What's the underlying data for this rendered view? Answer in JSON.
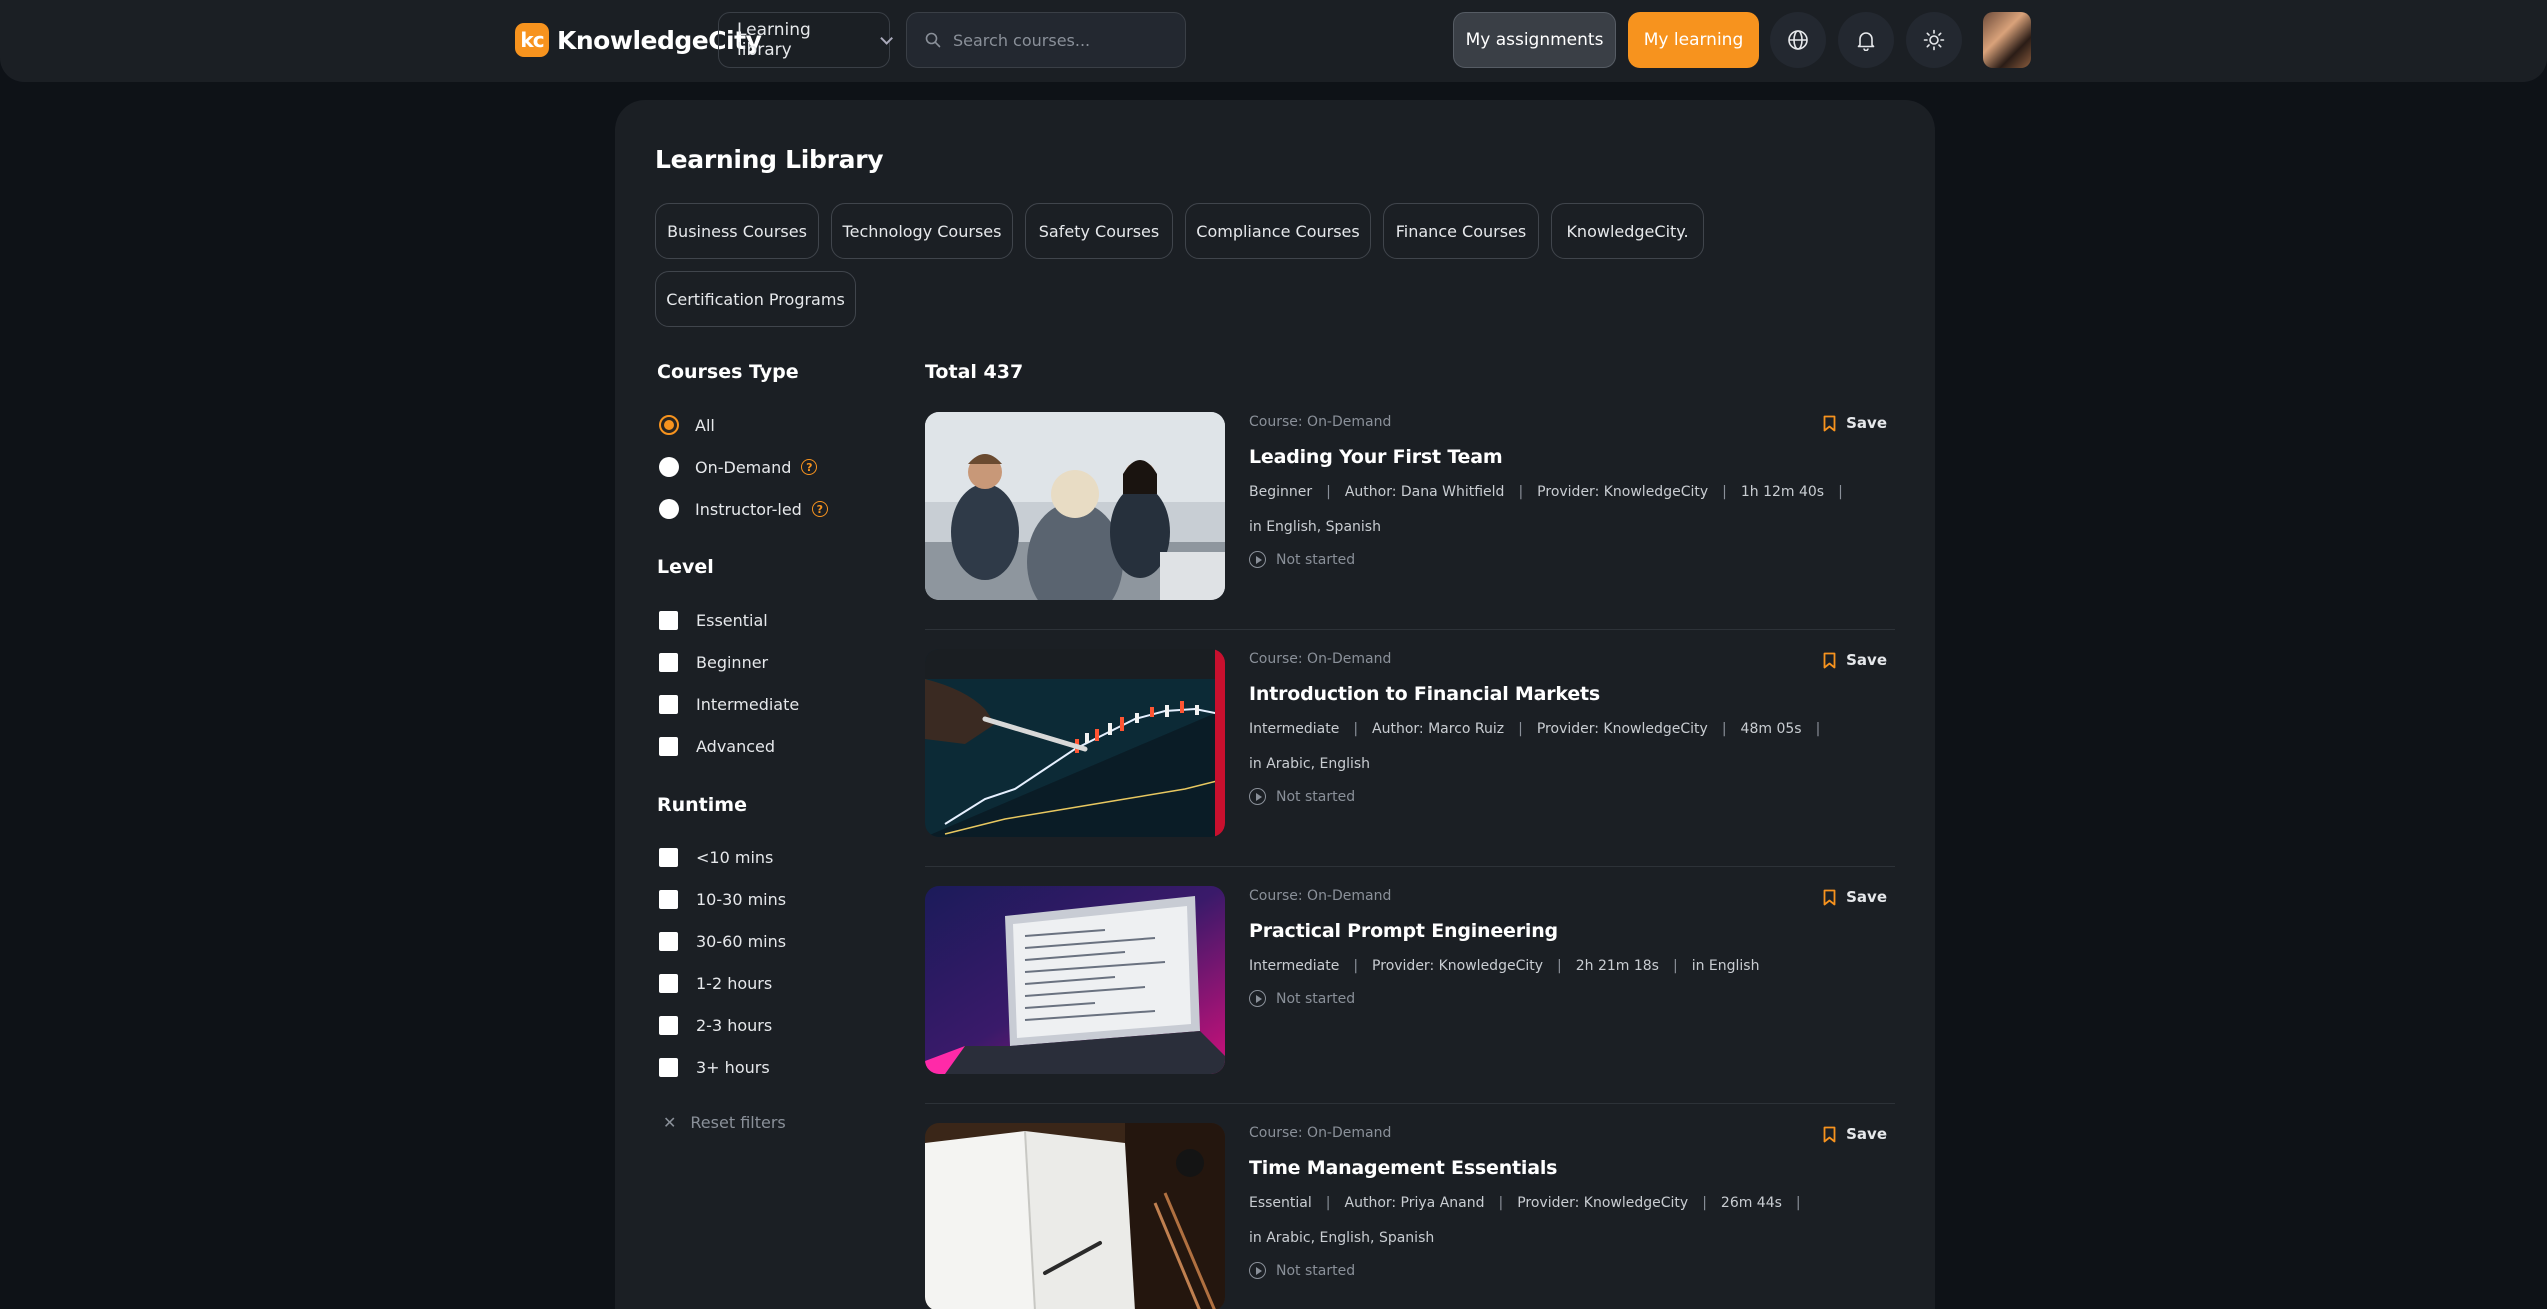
{
  "header": {
    "logo_mark": "kc",
    "brand": "KnowledgeCity",
    "library_dropdown": "Learning library",
    "search_placeholder": "Search courses...",
    "my_assignments": "My assignments",
    "my_learning": "My learning",
    "icons": [
      "globe-icon",
      "bell-icon",
      "sun-icon"
    ]
  },
  "colors": {
    "accent": "#f7931e",
    "background": "#0e1217",
    "panel": "#1b1f24"
  },
  "page": {
    "title": "Learning Library",
    "categories": [
      "Business Courses",
      "Technology Courses",
      "Safety Courses",
      "Compliance Courses",
      "Finance Courses",
      "KnowledgeCity.",
      "Certification Programs"
    ]
  },
  "filters": {
    "courses_type": {
      "heading": "Courses Type",
      "options": [
        "All",
        "On-Demand",
        "Instructor-led"
      ],
      "selected": "All"
    },
    "level": {
      "heading": "Level",
      "options": [
        "Essential",
        "Beginner",
        "Intermediate",
        "Advanced"
      ]
    },
    "runtime": {
      "heading": "Runtime",
      "options": [
        "<10 mins",
        "10-30 mins",
        "30-60 mins",
        "1-2 hours",
        "2-3 hours",
        "3+ hours"
      ]
    },
    "reset": "Reset filters"
  },
  "results": {
    "total": "Total 437",
    "courses": [
      {
        "type": "Course: On-Demand",
        "title": "Leading Your First Team",
        "meta": [
          "Beginner",
          "Author: Dana Whitfield",
          "Provider: KnowledgeCity",
          "1h 12m 40s"
        ],
        "language": "in English, Spanish",
        "status": "Not started",
        "save": "Save"
      },
      {
        "type": "Course: On-Demand",
        "title": "Introduction to Financial Markets",
        "meta": [
          "Intermediate",
          "Author: Marco Ruiz",
          "Provider: KnowledgeCity",
          "48m 05s"
        ],
        "language": "in Arabic, English",
        "status": "Not started",
        "save": "Save"
      },
      {
        "type": "Course: On-Demand",
        "title": "Practical Prompt Engineering",
        "meta": [
          "Intermediate",
          "Provider: KnowledgeCity",
          "2h 21m 18s",
          "in English"
        ],
        "language": "",
        "status": "Not started",
        "save": "Save"
      },
      {
        "type": "Course: On-Demand",
        "title": "Time Management Essentials",
        "meta": [
          "Essential",
          "Author: Priya Anand",
          "Provider: KnowledgeCity",
          "26m 44s"
        ],
        "language": "in Arabic, English, Spanish",
        "status": "Not started",
        "save": "Save"
      }
    ]
  }
}
